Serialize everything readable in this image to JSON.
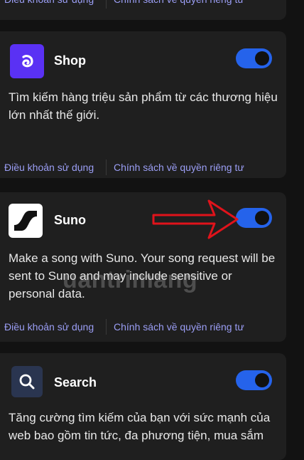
{
  "terms_label": "Điều khoản sử dụng",
  "privacy_label": "Chính sách về quyền riêng tư",
  "apps": [
    {
      "name": "Shop",
      "icon": "shop-icon",
      "enabled": true,
      "description": "Tìm kiếm hàng triệu sản phẩm từ các thương hiệu lớn nhất thế giới."
    },
    {
      "name": "Suno",
      "icon": "suno-wave-icon",
      "enabled": true,
      "description": "Make a song with Suno. Your song request will be sent to Suno and may include sensitive or personal data."
    },
    {
      "name": "Search",
      "icon": "search-icon",
      "enabled": true,
      "description": "Tăng cường tìm kiếm của bạn với sức mạnh của web bao gồm tin tức, đa phương tiện, mua sắm"
    }
  ],
  "watermark": "uantrimang",
  "colors": {
    "toggle_on": "#2563eb",
    "link": "#9b9ef5",
    "annotation_arrow": "#e0131b",
    "shop_icon_bg": "#5a31f4"
  }
}
